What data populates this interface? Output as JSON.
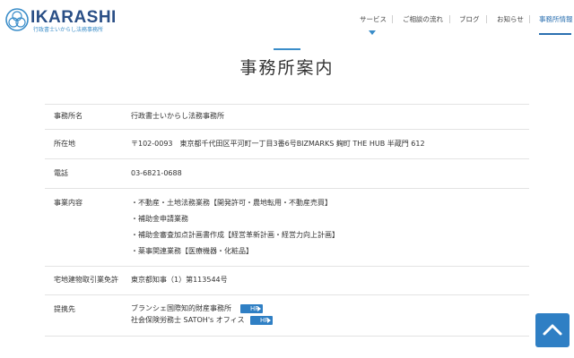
{
  "brand": {
    "name": "IKARASHI",
    "subtitle": "行政書士いからし法務事務所"
  },
  "nav": {
    "items": [
      {
        "label": "サービス"
      },
      {
        "label": "ご相談の流れ"
      },
      {
        "label": "ブログ"
      },
      {
        "label": "お知らせ"
      },
      {
        "label": "事務所情報"
      }
    ]
  },
  "page": {
    "title": "事務所案内"
  },
  "office": {
    "rows": [
      {
        "label": "事務所名",
        "value": "行政書士いからし法務事務所"
      },
      {
        "label": "所在地",
        "value": "〒102-0093　東京都千代田区平河町一丁目3番6号BIZMARKS 麹町 THE HUB 半蔵門 612"
      },
      {
        "label": "電話",
        "value": "03-6821-0688"
      },
      {
        "label": "事業内容",
        "items": [
          "・不動産・土地法務業務【開発許可・農地転用・不動産売買】",
          "・補助金申請業務",
          "・補助金審査加点計画書作成【経営革新計画・経営力向上計画】",
          "・薬事関連業務【医療機器・化粧品】"
        ]
      },
      {
        "label": "宅地建物取引業免許",
        "value": "東京都知事（1）第113544号"
      },
      {
        "label": "提携先",
        "partners": [
          {
            "name": "ブランシェ国際知的財産事務所",
            "link_label": "HP"
          },
          {
            "name": "社会保険労務士 SATOH's オフィス",
            "link_label": "HP"
          }
        ]
      }
    ]
  },
  "colors": {
    "accent": "#2f7fc4",
    "brand": "#2a4f86"
  },
  "icons": {
    "back_to_top": "chevron-up-icon",
    "link_arrow": "triangle-right-icon"
  }
}
